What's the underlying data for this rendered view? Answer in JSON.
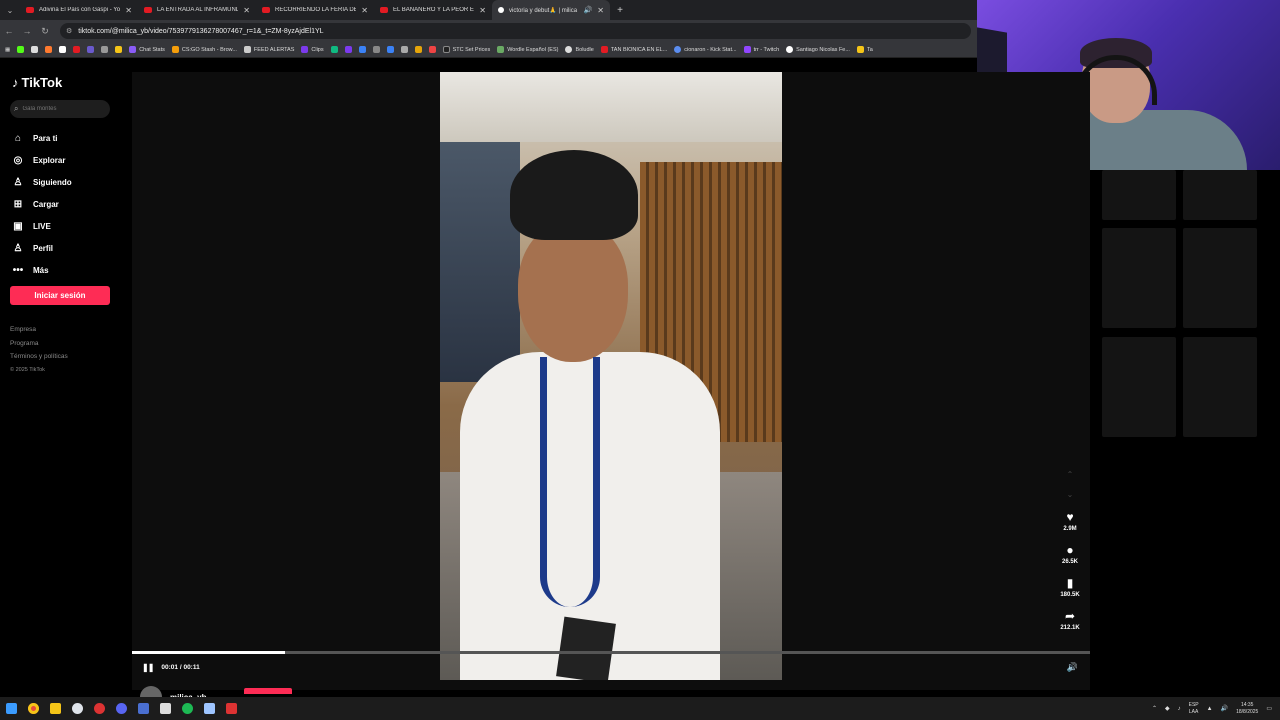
{
  "browser": {
    "tabs": [
      {
        "label": "Adivina El País con Gaspi - You",
        "icon": "youtube-icon",
        "active": false
      },
      {
        "label": "LA ENTRADA AL INFRAMUNDO",
        "icon": "youtube-icon",
        "active": false
      },
      {
        "label": "RECORRIENDO LA FERIA DE SO",
        "icon": "youtube-icon",
        "active": false
      },
      {
        "label": "EL BANANERO Y LA PEOR ENT",
        "icon": "youtube-icon",
        "active": false
      },
      {
        "label": "victoria y debut🙏 | milica",
        "icon": "tiktok-icon",
        "active": true
      }
    ],
    "url": "tiktok.com/@milica_yb/video/7539779136278007467_r=1&_t=ZM-8yzAjdEl1YL",
    "bookmarks": [
      "Chat Stats",
      "CS:GO Stash - Brow...",
      "FEED ALERTAS",
      "Clips",
      "STC Set Prices",
      "Wordle Español (ES)",
      "Boludle",
      "TAN BIONICA EN EL...",
      "cionaron - Kick Stat...",
      "trr - Twitch",
      "Santiago Nicolas Fe...",
      "Ta"
    ]
  },
  "tiktok": {
    "logo": "TikTok",
    "search_placeholder": "Gala montes",
    "nav": [
      {
        "label": "Para ti",
        "icon": "home-icon"
      },
      {
        "label": "Explorar",
        "icon": "compass-icon"
      },
      {
        "label": "Siguiendo",
        "icon": "following-icon"
      },
      {
        "label": "Cargar",
        "icon": "upload-icon"
      },
      {
        "label": "LIVE",
        "icon": "live-icon"
      },
      {
        "label": "Perfil",
        "icon": "profile-icon"
      },
      {
        "label": "Más",
        "icon": "more-icon"
      }
    ],
    "login_label": "Iniciar sesión",
    "footer": [
      "Empresa",
      "Programa",
      "Términos y políticas"
    ],
    "copyright": "© 2025 TikTok",
    "actions": {
      "likes": "2.9M",
      "comments": "26.5K",
      "saves": "180.5K",
      "shares": "212.1K"
    },
    "player": {
      "time": "00:01 / 00:11",
      "progress": 0.16
    },
    "author": "milica_yb"
  },
  "taskbar": {
    "lang_top": "ESP",
    "lang_bottom": "LAA",
    "time": "14:35",
    "date": "18/8/2025"
  }
}
